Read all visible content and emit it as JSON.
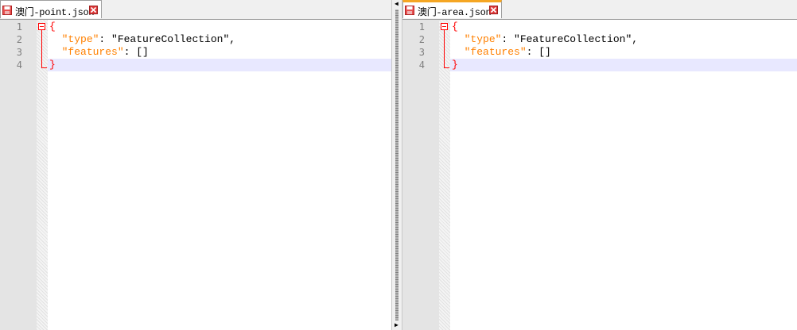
{
  "left": {
    "tab_label": "澳门-point.json",
    "lines": [
      "1",
      "2",
      "3",
      "4"
    ],
    "code": {
      "open": "{",
      "type_key": "\"type\"",
      "type_sep": ": ",
      "type_val": "\"FeatureCollection\",",
      "features_key": "\"features\"",
      "features_sep": ": ",
      "features_val": "[]",
      "close": "}"
    }
  },
  "right": {
    "tab_label": "澳门-area.json",
    "lines": [
      "1",
      "2",
      "3",
      "4"
    ],
    "code": {
      "open": "{",
      "type_key": "\"type\"",
      "type_sep": ": ",
      "type_val": "\"FeatureCollection\",",
      "features_key": "\"features\"",
      "features_sep": ": ",
      "features_val": "[]",
      "close": "}"
    }
  },
  "icons": {
    "save": "save-file-icon",
    "close": "close-tab-icon",
    "split_left": "arrow-left-icon",
    "split_right": "arrow-right-icon"
  }
}
